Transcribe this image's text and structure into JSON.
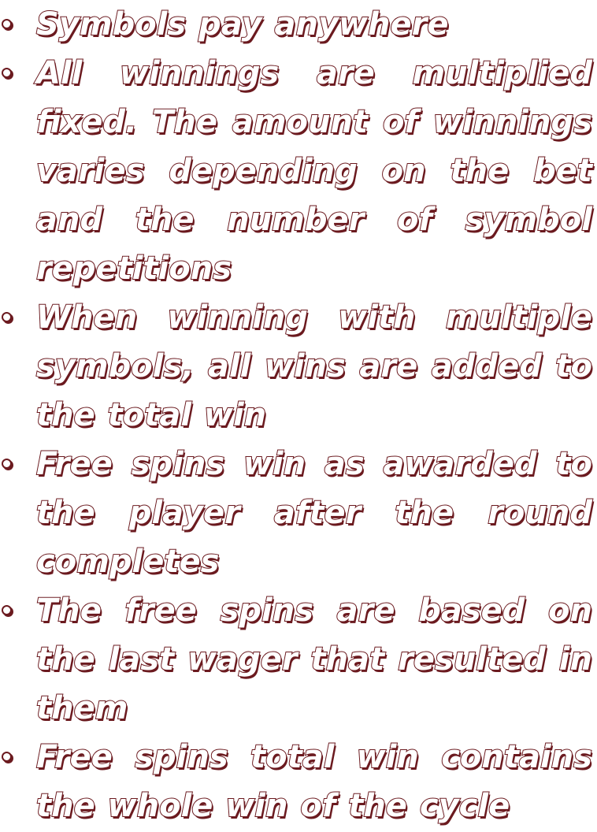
{
  "rules": {
    "items": [
      {
        "text": "Symbols pay anywhere"
      },
      {
        "text": "All winnings are multiplied fixed. The amount of winnings varies depending on the bet and the number of symbol repetitions"
      },
      {
        "text": "When winning with multiple symbols, all wins are added to the total win"
      },
      {
        "text": "Free spins win as awarded to the player after the round completes"
      },
      {
        "text": "The free spins are based on the last wager that resulted in them"
      },
      {
        "text": "Free spins total win contains the whole win of the cycle"
      }
    ]
  },
  "colors": {
    "text_outline": "#6b1a1f",
    "text_fill": "#ffffff",
    "background": "#ffffff"
  }
}
